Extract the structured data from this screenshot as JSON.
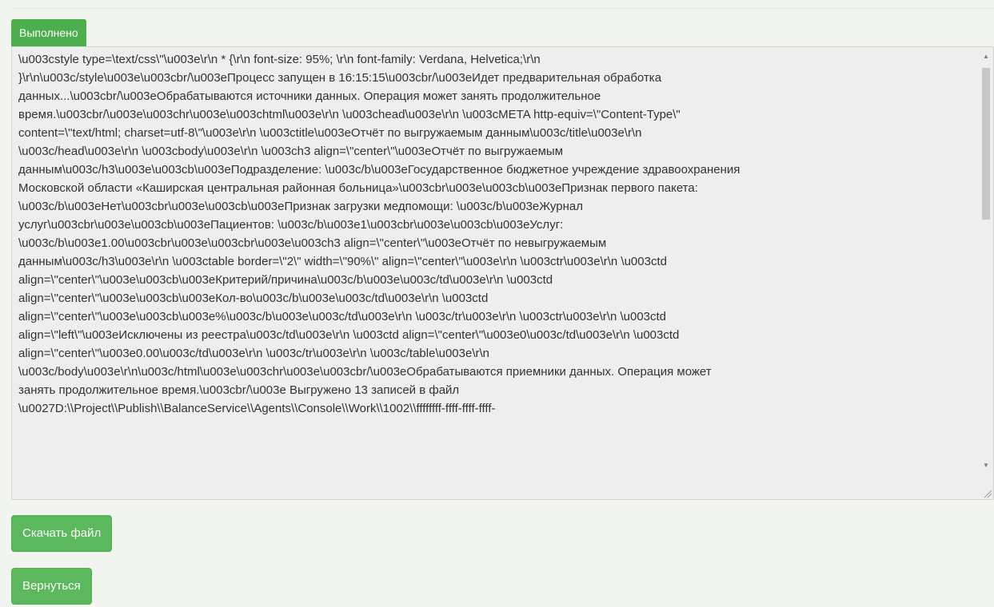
{
  "status_label": "Выполнено",
  "log": {
    "lines": [
      "\\u003cstyle type=\\text/css\\\"\\u003e\\r\\n  * {\\r\\n    font-size: 95%; \\r\\n    font-family: Verdana, Helvetica;\\r\\n",
      "}\\r\\n\\u003c/style\\u003e\\u003cbr/\\u003eПроцесс запущен в 16:15:15\\u003cbr/\\u003eИдет предварительная обработка",
      "данных...\\u003cbr/\\u003eОбрабатываются источники данных. Операция может занять продолжительное",
      "время.\\u003cbr/\\u003e\\u003chr\\u003e\\u003chtml\\u003e\\r\\n  \\u003chead\\u003e\\r\\n    \\u003cMETA http-equiv=\\\"Content-Type\\\"",
      "content=\\\"text/html; charset=utf-8\\\"\\u003e\\r\\n    \\u003ctitle\\u003eОтчёт по выгружаемым данным\\u003c/title\\u003e\\r\\n",
      "\\u003c/head\\u003e\\r\\n  \\u003cbody\\u003e\\r\\n    \\u003ch3 align=\\\"center\\\"\\u003eОтчёт по выгружаемым",
      "данным\\u003c/h3\\u003e\\u003cb\\u003eПодразделение: \\u003c/b\\u003eГосударственное бюджетное учреждение здравоохранения",
      "Московской области «Каширская центральная районная больница»\\u003cbr\\u003e\\u003cb\\u003eПризнак первого пакета:",
      "\\u003c/b\\u003eНет\\u003cbr\\u003e\\u003cb\\u003eПризнак загрузки медпомощи: \\u003c/b\\u003eЖурнал",
      "услуг\\u003cbr\\u003e\\u003cb\\u003eПациентов: \\u003c/b\\u003e1\\u003cbr\\u003e\\u003cb\\u003eУслуг:",
      "\\u003c/b\\u003e1.00\\u003cbr\\u003e\\u003cbr\\u003e\\u003ch3 align=\\\"center\\\"\\u003eОтчёт по невыгружаемым",
      "данным\\u003c/h3\\u003e\\r\\n    \\u003ctable border=\\\"2\\\" width=\\\"90%\\\" align=\\\"center\\\"\\u003e\\r\\n      \\u003ctr\\u003e\\r\\n        \\u003ctd",
      "align=\\\"center\\\"\\u003e\\u003cb\\u003eКритерий/причина\\u003c/b\\u003e\\u003c/td\\u003e\\r\\n        \\u003ctd",
      "align=\\\"center\\\"\\u003e\\u003cb\\u003eКол-во\\u003c/b\\u003e\\u003c/td\\u003e\\r\\n        \\u003ctd",
      "align=\\\"center\\\"\\u003e\\u003cb\\u003e%\\u003c/b\\u003e\\u003c/td\\u003e\\r\\n      \\u003c/tr\\u003e\\r\\n      \\u003ctr\\u003e\\r\\n        \\u003ctd",
      "align=\\\"left\\\"\\u003eИсключены из реестра\\u003c/td\\u003e\\r\\n        \\u003ctd align=\\\"center\\\"\\u003e0\\u003c/td\\u003e\\r\\n        \\u003ctd",
      "align=\\\"center\\\"\\u003e0.00\\u003c/td\\u003e\\r\\n      \\u003c/tr\\u003e\\r\\n    \\u003c/table\\u003e\\r\\n",
      "\\u003c/body\\u003e\\r\\n\\u003c/html\\u003e\\u003chr\\u003e\\u003cbr/\\u003eОбрабатываются приемники данных. Операция может",
      "занять продолжительное время.\\u003cbr/\\u003e Выгружено 13 записей в файл",
      "\\u0027D:\\\\Project\\\\Publish\\\\BalanceService\\\\Agents\\\\Console\\\\Work\\\\1002\\\\ffffffff-ffff-ffff-ffff-"
    ]
  },
  "buttons": {
    "download": "Скачать файл",
    "back": "Вернуться"
  },
  "colors": {
    "success": "#5cb85c",
    "success_border": "#4cae4c",
    "background": "#f2f5ef",
    "log_background": "#eeeeee"
  },
  "icons": {
    "scroll_up": "scroll-up-arrow-icon",
    "scroll_down": "scroll-down-arrow-icon",
    "resize": "resize-grip-icon"
  }
}
